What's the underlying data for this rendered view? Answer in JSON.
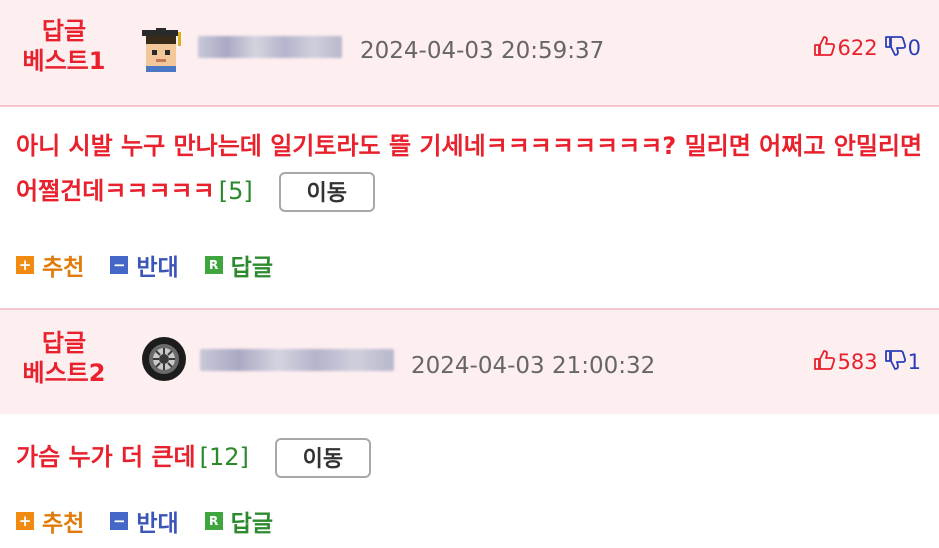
{
  "comments": [
    {
      "badge_line1": "답글",
      "badge_line2": "베스트1",
      "avatar_icon": "graduate-face-icon",
      "timestamp": "2024-04-03 20:59:37",
      "likes": "622",
      "dislikes": "0",
      "text": "아니 시발 누구 만나는데 일기토라도 뜰 기세네ㅋㅋㅋㅋㅋㅋㅋㅋ? 밀리면 어쩌고 안밀리면 어쩔건데ㅋㅋㅋㅋㅋ",
      "reply_count": "[5]",
      "move_label": "이동",
      "recommend_label": "추천",
      "oppose_label": "반대",
      "reply_label": "답글"
    },
    {
      "badge_line1": "답글",
      "badge_line2": "베스트2",
      "avatar_icon": "tire-icon",
      "timestamp": "2024-04-03 21:00:32",
      "likes": "583",
      "dislikes": "1",
      "text": "가슴 누가 더 큰데",
      "reply_count": "[12]",
      "move_label": "이동",
      "recommend_label": "추천",
      "oppose_label": "반대",
      "reply_label": "답글"
    }
  ],
  "icons": {
    "recommend": "plus-icon",
    "oppose": "minus-icon",
    "reply": "reply-r-icon",
    "like": "thumbs-up-icon",
    "dislike": "thumbs-down-icon"
  },
  "colors": {
    "accent_red": "#e8212d",
    "header_bg": "#fdeef0",
    "reply_count_green": "#2a8a2a",
    "recommend_orange": "#f08a10",
    "oppose_blue": "#4568c8",
    "reply_green": "#3fa63f"
  }
}
